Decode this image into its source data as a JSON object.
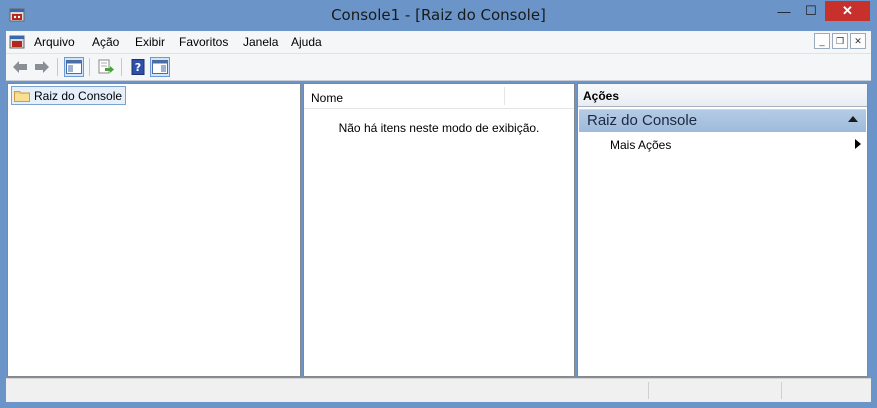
{
  "window": {
    "title": "Console1 - [Raiz do Console]",
    "controls": {
      "minimize": "—",
      "maximize": "☐",
      "close": "✕"
    }
  },
  "menu": {
    "items": [
      "Arquivo",
      "Ação",
      "Exibir",
      "Favoritos",
      "Janela",
      "Ajuda"
    ],
    "mdi": {
      "minimize": "_",
      "restore": "❐",
      "close": "✕"
    }
  },
  "toolbar": {
    "icons": [
      "back-icon",
      "forward-icon",
      "show-hide-tree-icon",
      "export-list-icon",
      "help-icon",
      "show-hide-action-pane-icon"
    ]
  },
  "tree": {
    "root_label": "Raiz do Console"
  },
  "list": {
    "column_name": "Nome",
    "empty_message": "Não há itens neste modo de exibição."
  },
  "actions": {
    "header": "Ações",
    "section_title": "Raiz do Console",
    "items": [
      "Mais Ações"
    ]
  },
  "colors": {
    "frame": "#6b95c9",
    "close_button": "#c7302b",
    "selection": "#e5f0fb",
    "section_band": "#a9c2df"
  }
}
